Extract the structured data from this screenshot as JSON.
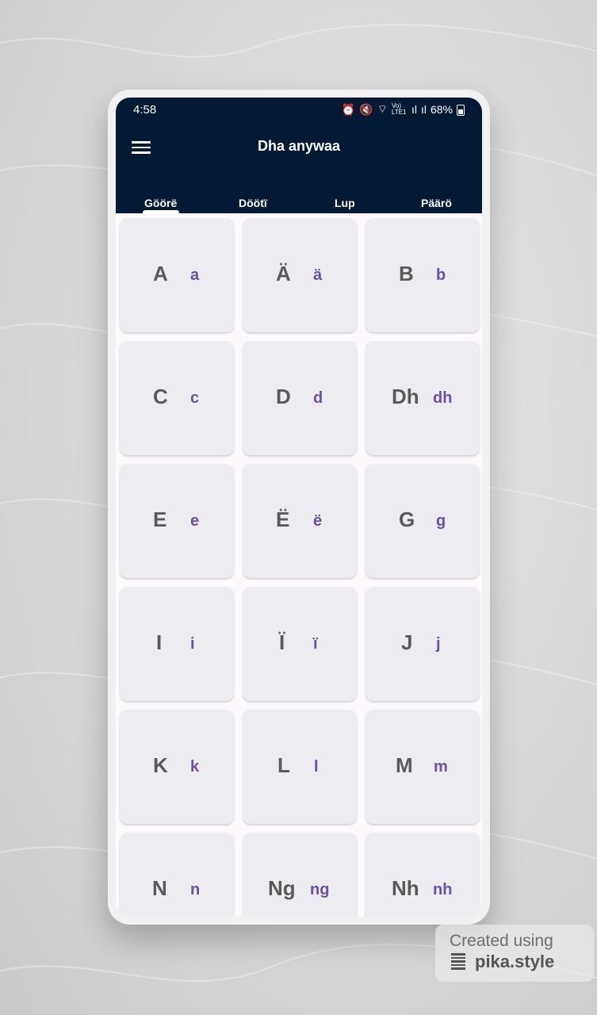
{
  "status_bar": {
    "time": "4:58",
    "network": "Vo) LTE1",
    "battery": "68%"
  },
  "app_bar": {
    "title": "Dha anywaa"
  },
  "tabs": [
    {
      "label": "Göörë",
      "selected": true
    },
    {
      "label": "Döötï",
      "selected": false
    },
    {
      "label": "Lup",
      "selected": false
    },
    {
      "label": "Päärö",
      "selected": false
    }
  ],
  "letters": [
    {
      "upper": "A",
      "lower": "a"
    },
    {
      "upper": "Ä",
      "lower": "ä"
    },
    {
      "upper": "B",
      "lower": "b"
    },
    {
      "upper": "C",
      "lower": "c"
    },
    {
      "upper": "D",
      "lower": "d"
    },
    {
      "upper": "Dh",
      "lower": "dh"
    },
    {
      "upper": "E",
      "lower": "e"
    },
    {
      "upper": "Ë",
      "lower": "ë"
    },
    {
      "upper": "G",
      "lower": "g"
    },
    {
      "upper": "I",
      "lower": "i"
    },
    {
      "upper": "Ï",
      "lower": "ï"
    },
    {
      "upper": "J",
      "lower": "j"
    },
    {
      "upper": "K",
      "lower": "k"
    },
    {
      "upper": "L",
      "lower": "l"
    },
    {
      "upper": "M",
      "lower": "m"
    },
    {
      "upper": "N",
      "lower": "n"
    },
    {
      "upper": "Ng",
      "lower": "ng"
    },
    {
      "upper": "Nh",
      "lower": "nh"
    }
  ],
  "watermark": {
    "line1": "Created using",
    "line2": "pika.style"
  },
  "colors": {
    "app_bar": "#021a34",
    "card_bg": "#edecf1",
    "uppercase_text": "#5a5a5a",
    "lowercase_text": "#6b4fa8"
  },
  "icons": {
    "menu": "hamburger-menu-icon",
    "alarm": "alarm-icon",
    "mute": "mute-icon",
    "wifi": "wifi-icon",
    "signal": "signal-icon",
    "battery": "battery-icon"
  }
}
